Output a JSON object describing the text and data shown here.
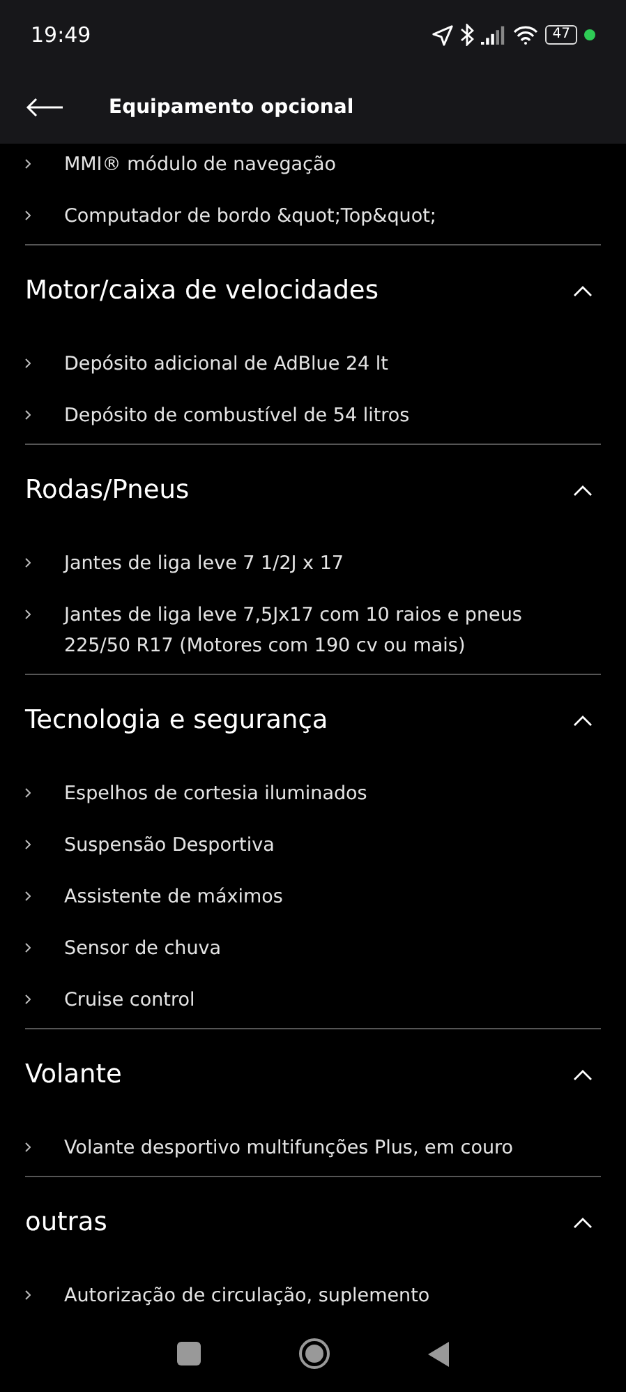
{
  "status_bar": {
    "time": "19:49",
    "battery": "47"
  },
  "header": {
    "title": "Equipamento opcional"
  },
  "top_items": [
    "MMI® módulo de navegação",
    "Computador de bordo &quot;Top&quot;"
  ],
  "sections": [
    {
      "title": "Motor/caixa de velocidades",
      "expanded": true,
      "items": [
        "Depósito adicional de AdBlue 24 lt",
        "Depósito de combustível de 54 litros"
      ]
    },
    {
      "title": "Rodas/Pneus",
      "expanded": true,
      "items": [
        "Jantes de liga leve 7 1/2J x 17",
        "Jantes de liga leve 7,5Jx17 com 10 raios e pneus 225/50 R17 (Motores com 190 cv ou mais)"
      ]
    },
    {
      "title": "Tecnologia e segurança",
      "expanded": true,
      "items": [
        "Espelhos de cortesia iluminados",
        "Suspensão Desportiva",
        "Assistente de máximos",
        "Sensor de chuva",
        "Cruise control"
      ]
    },
    {
      "title": "Volante",
      "expanded": true,
      "items": [
        "Volante desportivo multifunções Plus, em couro"
      ]
    },
    {
      "title": "outras",
      "expanded": true,
      "items": [
        "Autorização de circulação, suplemento"
      ]
    }
  ]
}
